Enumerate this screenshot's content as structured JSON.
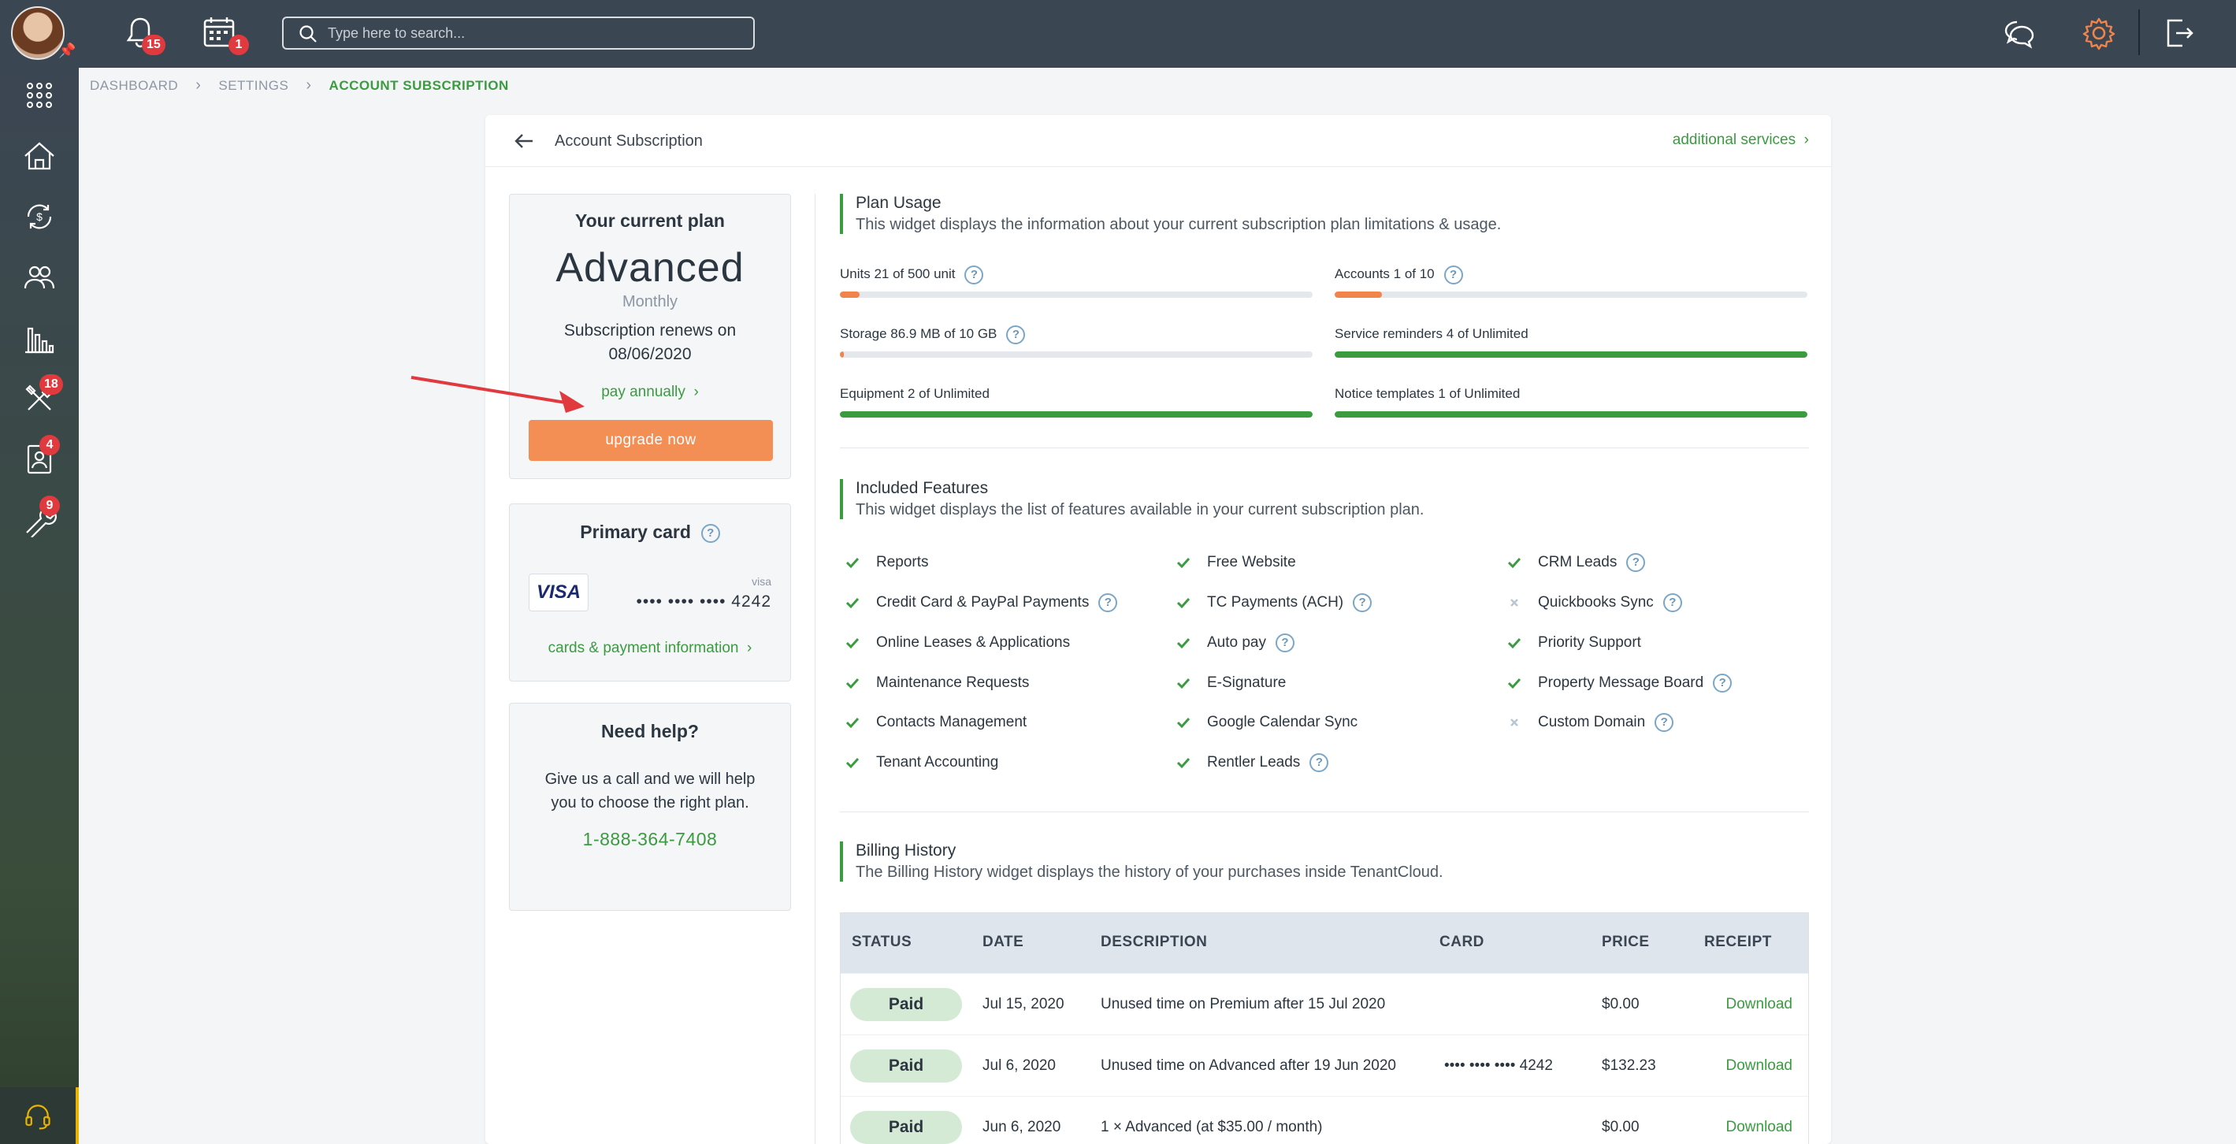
{
  "topbar": {
    "notifications_count": "15",
    "calendar_count": "1",
    "search_placeholder": "Type here to search..."
  },
  "sidebar": {
    "badges": {
      "tools": "18",
      "contacts": "4",
      "maintenance": "9"
    }
  },
  "breadcrumbs": [
    "DASHBOARD",
    "SETTINGS",
    "ACCOUNT SUBSCRIPTION"
  ],
  "page": {
    "title": "Account Subscription",
    "additional_services": "additional services"
  },
  "plan": {
    "heading": "Your current plan",
    "name": "Advanced",
    "period": "Monthly",
    "renew_line1": "Subscription renews on",
    "renew_date": "08/06/2020",
    "pay_annually": "pay annually",
    "upgrade": "upgrade now"
  },
  "primary_card": {
    "heading": "Primary card",
    "brand": "VISA",
    "brand_label": "visa",
    "number": "•••• •••• •••• 4242",
    "link": "cards & payment information"
  },
  "help": {
    "heading": "Need help?",
    "text": "Give us a call and we will help you to choose the right plan.",
    "phone": "1-888-364-7408"
  },
  "plan_usage": {
    "title": "Plan Usage",
    "desc": "This widget displays the information about your current subscription plan limitations & usage.",
    "items": [
      {
        "label": "Units 21 of 500 unit",
        "help": true,
        "fill": 0.042,
        "color": "#f0844a"
      },
      {
        "label": "Accounts 1 of 10",
        "help": true,
        "fill": 0.1,
        "color": "#f0844a"
      },
      {
        "label": "Storage 86.9 MB of 10 GB",
        "help": true,
        "fill": 0.008,
        "color": "#f0844a"
      },
      {
        "label": "Service reminders 4 of Unlimited",
        "help": false,
        "fill": 1,
        "color": "#3a9b3f"
      },
      {
        "label": "Equipment 2 of Unlimited",
        "help": false,
        "fill": 1,
        "color": "#3a9b3f"
      },
      {
        "label": "Notice templates 1 of Unlimited",
        "help": false,
        "fill": 1,
        "color": "#3a9b3f"
      }
    ]
  },
  "features": {
    "title": "Included Features",
    "desc": "This widget displays the list of features available in your current subscription plan.",
    "columns": [
      [
        {
          "label": "Reports",
          "on": true,
          "help": false
        },
        {
          "label": "Credit Card & PayPal Payments",
          "on": true,
          "help": true
        },
        {
          "label": "Online Leases & Applications",
          "on": true,
          "help": false
        },
        {
          "label": "Maintenance Requests",
          "on": true,
          "help": false
        },
        {
          "label": "Contacts Management",
          "on": true,
          "help": false
        },
        {
          "label": "Tenant Accounting",
          "on": true,
          "help": false
        }
      ],
      [
        {
          "label": "Free Website",
          "on": true,
          "help": false
        },
        {
          "label": "TC Payments (ACH)",
          "on": true,
          "help": true
        },
        {
          "label": "Auto pay",
          "on": true,
          "help": true
        },
        {
          "label": "E-Signature",
          "on": true,
          "help": false
        },
        {
          "label": "Google Calendar Sync",
          "on": true,
          "help": false
        },
        {
          "label": "Rentler Leads",
          "on": true,
          "help": true
        }
      ],
      [
        {
          "label": "CRM Leads",
          "on": true,
          "help": true
        },
        {
          "label": "Quickbooks Sync",
          "on": false,
          "help": true
        },
        {
          "label": "Priority Support",
          "on": true,
          "help": false
        },
        {
          "label": "Property Message Board",
          "on": true,
          "help": true
        },
        {
          "label": "Custom Domain",
          "on": false,
          "help": true
        }
      ]
    ]
  },
  "billing": {
    "title": "Billing History",
    "desc": "The Billing History widget displays the history of your purchases inside TenantCloud.",
    "headers": [
      "STATUS",
      "DATE",
      "DESCRIPTION",
      "CARD",
      "PRICE",
      "RECEIPT"
    ],
    "rows": [
      {
        "status": "Paid",
        "date": "Jul 15, 2020",
        "description": "Unused time on Premium after 15 Jul 2020",
        "card": "",
        "price": "$0.00",
        "receipt": "Download"
      },
      {
        "status": "Paid",
        "date": "Jul 6, 2020",
        "description": "Unused time on Advanced after 19 Jun 2020",
        "card": "•••• •••• •••• 4242",
        "price": "$132.23",
        "receipt": "Download"
      },
      {
        "status": "Paid",
        "date": "Jun 6, 2020",
        "description": "1 × Advanced (at $35.00 / month)",
        "card": "",
        "price": "$0.00",
        "receipt": "Download"
      }
    ]
  },
  "colors": {
    "accent": "#3a9b3f",
    "orange": "#f38f55",
    "topbar": "#3b4653",
    "badge": "#e03a3f"
  }
}
